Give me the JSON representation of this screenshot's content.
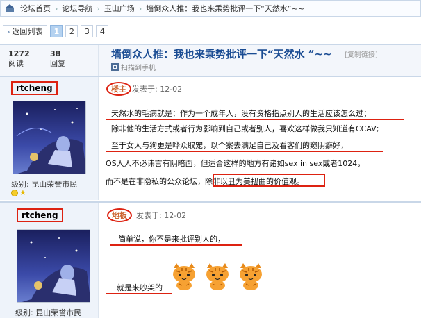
{
  "breadcrumb": {
    "items": [
      "论坛首页",
      "论坛导航",
      "玉山广场",
      "墙倒众人推：我也来乘势批评一下“天然水”~~"
    ],
    "separator": "›"
  },
  "pager": {
    "back_label": "返回列表",
    "pages": [
      "1",
      "2",
      "3",
      "4"
    ],
    "current_page": "1"
  },
  "thread": {
    "views": "1272",
    "views_label": "阅读",
    "replies": "38",
    "replies_label": "回复",
    "title": "墙倒众人推：我也来乘势批评一下“天然水 ”~~",
    "copy_link": "[复制链接]",
    "scan_label": "扫描到手机"
  },
  "posts": [
    {
      "author": "rtcheng",
      "role_badge": "楼主",
      "time": "发表于: 12-02",
      "rank": "级别: 昆山荣誉市民",
      "lines": [
        "天然水的毛病就是：作为一个成年人，没有资格指点别人的生活应该怎么过；",
        "除非他的生活方式或者行为影响到自己或者别人，喜欢这样做我只知道有CCAV;",
        "至于女人与狗更是哗众取宠，以个案去满足自己及看客们的窥阴癖好，",
        "OS人人不必讳言有阴暗面，但适合这样的地方有诸如sex in sex或者1024，",
        "而不是在非隐私的公众论坛，除非以丑为美扭曲的价值观。"
      ]
    },
    {
      "author": "rtcheng",
      "role_badge": "地板",
      "time": "发表于: 12-02",
      "rank": "级别: 昆山荣誉市民",
      "lines": [
        "简单说，你不是来批评别人的，",
        "就是来吵架的"
      ]
    }
  ],
  "colors": {
    "annotation_red": "#dd1111",
    "title_blue": "#1a4c93",
    "pager_active": "#b5d2f0"
  }
}
